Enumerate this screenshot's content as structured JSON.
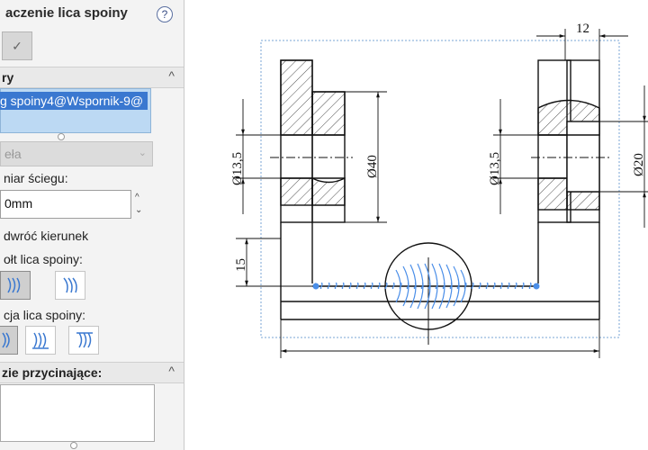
{
  "panel": {
    "title": "aczenie lica spoiny",
    "help_glyph": "?",
    "pin_glyph": "✓",
    "section1": {
      "label": "ry",
      "chevron": "^"
    },
    "selection_item": "g spoiny4@Wspornik-9@",
    "combo_value": "eła",
    "combo_arrow": "⌄",
    "stitch_label": "niar ściegu:",
    "stitch_value": "0mm",
    "spin_up": "^",
    "spin_down": "⌄",
    "reverse_label": "dwróć kierunek",
    "shape_label": "ołt lica spoiny:",
    "position_label": "cja lica spoiny:",
    "section2": {
      "label": "zie przycinające:",
      "chevron": "^"
    }
  },
  "drawing": {
    "dim_top": "12",
    "dim_left_dia": "Ø13,5",
    "dim_dia40": "Ø40",
    "dim_right_dia": "Ø13,5",
    "dim_dia20": "Ø20",
    "dim_15": "15"
  },
  "colors": {
    "accent": "#3a78d0",
    "weld": "#4a8ee8",
    "selection_border": "#7aa6d6"
  }
}
